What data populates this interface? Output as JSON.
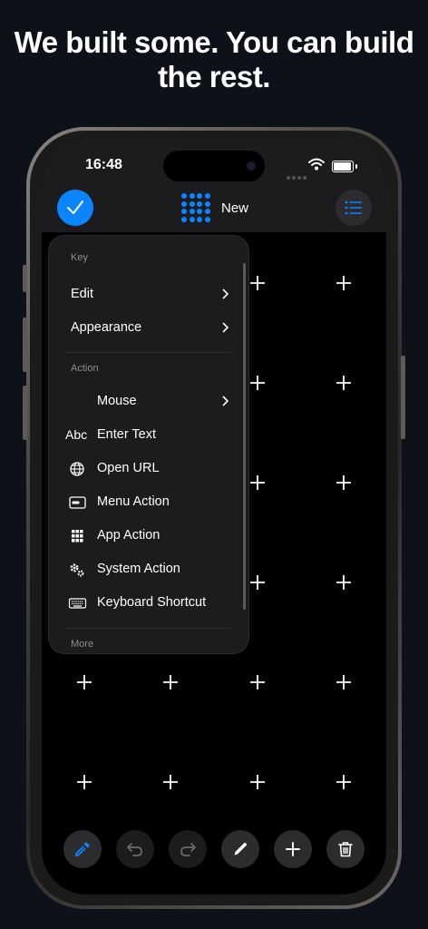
{
  "headline": {
    "line1": "We built some. You can build",
    "line2": "the rest."
  },
  "status": {
    "time": "16:48"
  },
  "header": {
    "title": "New",
    "done_icon": "checkmark-icon",
    "grid_icon": "grid-dots-icon",
    "list_icon": "list-icon"
  },
  "menu": {
    "sections": [
      {
        "label": "Key",
        "items": [
          {
            "label": "Edit",
            "chevron": true
          },
          {
            "label": "Appearance",
            "chevron": true
          }
        ]
      },
      {
        "label": "Action",
        "items": [
          {
            "label": "Mouse",
            "icon": "mouse-icon",
            "chevron": true
          },
          {
            "label": "Enter Text",
            "icon": "abc-text-icon",
            "icon_text": "Abc"
          },
          {
            "label": "Open URL",
            "icon": "globe-icon"
          },
          {
            "label": "Menu Action",
            "icon": "menubar-icon"
          },
          {
            "label": "App Action",
            "icon": "app-grid-icon"
          },
          {
            "label": "System Action",
            "icon": "gears-icon"
          },
          {
            "label": "Keyboard Shortcut",
            "icon": "keyboard-icon"
          }
        ]
      },
      {
        "label": "More",
        "items": []
      }
    ]
  },
  "toolbar": {
    "buttons": [
      "eyedropper-icon",
      "undo-icon",
      "redo-icon",
      "pencil-icon",
      "plus-icon",
      "trash-icon"
    ]
  },
  "colors": {
    "accent": "#0a84ff",
    "background": "#0d1119",
    "screen": "#000000",
    "panel": "#1c1c1e"
  }
}
